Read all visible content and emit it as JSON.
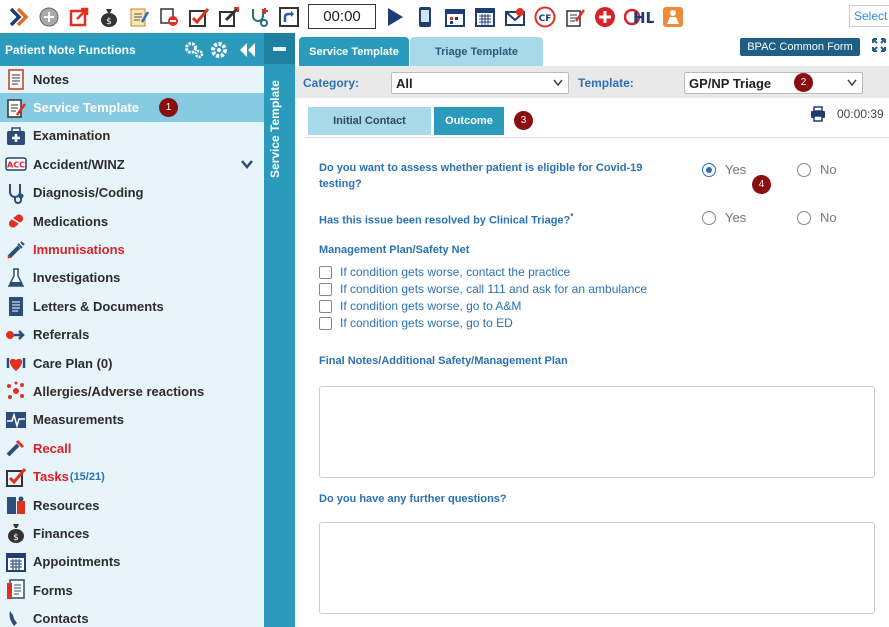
{
  "toolbar": {
    "timer": "00:00",
    "select_label": "Select",
    "icons": [
      "chevron-right-icon",
      "add-circle-icon",
      "export-icon",
      "money-bag-icon",
      "notepad-icon",
      "patient-record-icon",
      "checklist-icon",
      "edit-check-icon",
      "stethoscope-plus-icon",
      "shortcut-icon",
      "play-icon",
      "mobile-icon",
      "calendar-day-icon",
      "calendar-icon",
      "mail-icon",
      "cf-heart-icon",
      "edit-note-icon",
      "medic-icon",
      "hl-icon",
      "person-alert-icon"
    ]
  },
  "sidebar": {
    "title": "Patient Note Functions",
    "items": [
      {
        "label": "Notes",
        "icon": "notes-icon"
      },
      {
        "label": "Service Template",
        "icon": "service-template-icon",
        "active": true,
        "badge": "1"
      },
      {
        "label": "Examination",
        "icon": "medical-kit-icon"
      },
      {
        "label": "Accident/WINZ",
        "icon": "acc-icon",
        "has_chevron": true
      },
      {
        "label": "Diagnosis/Coding",
        "icon": "stethoscope-icon"
      },
      {
        "label": "Medications",
        "icon": "pill-icon"
      },
      {
        "label": "Immunisations",
        "icon": "syringe-icon",
        "red": true
      },
      {
        "label": "Investigations",
        "icon": "flask-icon"
      },
      {
        "label": "Letters & Documents",
        "icon": "document-icon"
      },
      {
        "label": "Referrals",
        "icon": "referral-icon"
      },
      {
        "label": "Care Plan (0)",
        "icon": "care-plan-icon"
      },
      {
        "label": "Allergies/Adverse reactions",
        "icon": "allergy-icon"
      },
      {
        "label": "Measurements",
        "icon": "measurements-icon"
      },
      {
        "label": "Recall",
        "icon": "recall-icon",
        "red": true
      },
      {
        "label": "Tasks",
        "icon": "tasks-icon",
        "red": true,
        "count": "(15/21)"
      },
      {
        "label": "Resources",
        "icon": "resources-icon"
      },
      {
        "label": "Finances",
        "icon": "finances-icon"
      },
      {
        "label": "Appointments",
        "icon": "appointments-icon"
      },
      {
        "label": "Forms",
        "icon": "forms-icon"
      },
      {
        "label": "Contacts",
        "icon": "contacts-icon"
      }
    ]
  },
  "vertical_panel": {
    "label": "Service Template"
  },
  "main": {
    "tabs": [
      {
        "label": "Service Template",
        "active": true
      },
      {
        "label": "Triage Template",
        "active": false
      }
    ],
    "bpac_button": "BPAC Common Form",
    "category_label": "Category:",
    "category_value": "All",
    "template_label": "Template:",
    "template_value": "GP/NP Triage",
    "template_badge": "2",
    "sub_tabs": [
      {
        "label": "Initial Contact",
        "active": false
      },
      {
        "label": "Outcome",
        "active": true
      }
    ],
    "sub_tab_badge": "3",
    "elapsed": "00:00:39",
    "form": {
      "q1": "Do you want to assess whether patient is eligible for Covid-19 testing?",
      "q1_yes": "Yes",
      "q1_no": "No",
      "q1_selected": "Yes",
      "q1_badge": "4",
      "q2": "Has this issue been resolved by Clinical Triage?",
      "q2_marker": "*",
      "q2_yes": "Yes",
      "q2_no": "No",
      "management_title": "Management Plan/Safety Net",
      "checkboxes": [
        "If condition gets worse, contact the practice",
        "If condition gets worse, call 111 and ask for an ambulance",
        "If condition gets worse, go to A&M",
        "If condition gets worse, go to ED"
      ],
      "final_notes_label": "Final Notes/Additional Safety/Management Plan",
      "further_questions_label": "Do you have any further questions?"
    }
  },
  "colors": {
    "accent": "#2a9bbd",
    "accent_dark": "#1f5f85",
    "sidebar_bg": "#e7f4f9",
    "active_item": "#86cbe1",
    "badge": "#8a0d12",
    "label_blue": "#2a72b5",
    "alert_red": "#e01f26"
  }
}
